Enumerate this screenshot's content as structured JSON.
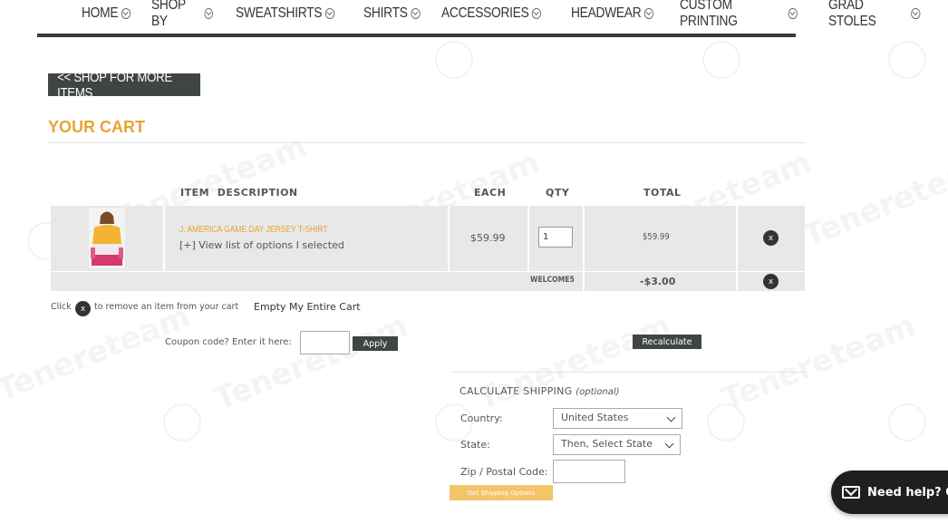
{
  "nav": {
    "items": [
      {
        "label": "HOME"
      },
      {
        "label": "SHOP BY"
      },
      {
        "label": "SWEATSHIRTS"
      },
      {
        "label": "SHIRTS"
      },
      {
        "label": "ACCESSORIES"
      },
      {
        "label": "HEADWEAR"
      },
      {
        "label": "CUSTOM PRINTING"
      },
      {
        "label": "GRAD STOLES"
      }
    ]
  },
  "shop_more_label": "<< SHOP FOR MORE ITEMS",
  "cart_title": "YOUR CART",
  "table": {
    "headers": {
      "item_description": "ITEM  DESCRIPTION",
      "each": "EACH",
      "qty": "QTY",
      "total": "TOTAL"
    },
    "item": {
      "name": "J. AMERICA GAME DAY JERSEY T-SHIRT",
      "options_link": "[+] View list of options I selected",
      "each": "$59.99",
      "qty": "1",
      "total": "$59.99",
      "remove": "x"
    },
    "coupon_row": {
      "code": "WELCOME5",
      "amount": "-$3.00",
      "remove": "x"
    }
  },
  "remove_hint": {
    "before": "Click",
    "x": "x",
    "after": "to remove an item from your cart"
  },
  "empty_cart_label": "Empty My Entire Cart",
  "coupon": {
    "label": "Coupon code? Enter it here:",
    "value": "",
    "apply_label": "Apply"
  },
  "recalculate_label": "Recalculate",
  "shipping": {
    "title": "CALCULATE SHIPPING",
    "optional": "(optional)",
    "country_label": "Country:",
    "country_value": "United States",
    "state_label": "State:",
    "state_value": "Then, Select State",
    "zip_label": "Zip / Postal Code:",
    "zip_value": "",
    "button_label": "Get Shipping Options"
  },
  "help_label": "Need help? C",
  "watermark_text": "Tenereteam",
  "colors": {
    "accent": "#e8a432",
    "dark_button": "#3f4540",
    "row_bg": "#e8e8e8",
    "ship_button": "#f3c46a"
  }
}
